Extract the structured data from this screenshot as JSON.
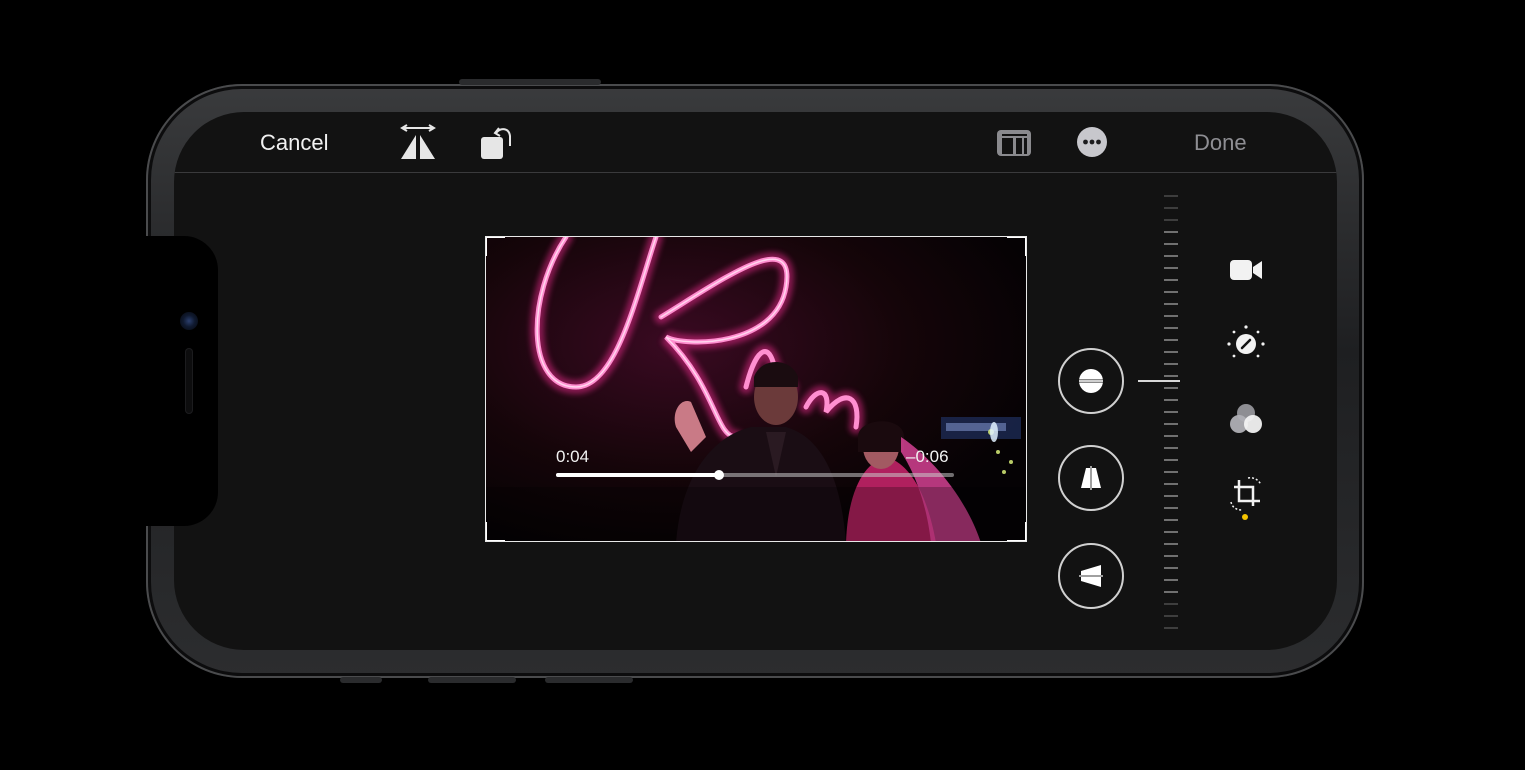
{
  "toolbar": {
    "cancel_label": "Cancel",
    "done_label": "Done",
    "flip_icon": "flip-horizontal-icon",
    "rotate_icon": "rotate-icon",
    "aspect_icon": "aspect-ratio-icon",
    "more_icon": "more-options-icon"
  },
  "video": {
    "elapsed": "0:04",
    "remaining": "–0:06",
    "progress": 0.41
  },
  "adjust_tools": {
    "straighten_icon": "straighten-icon",
    "vertical_icon": "vertical-perspective-icon",
    "horizontal_icon": "horizontal-perspective-icon"
  },
  "edit_modes": {
    "video_icon": "video-camera-icon",
    "adjust_icon": "adjust-dial-icon",
    "filters_icon": "filters-icon",
    "crop_icon": "crop-rotate-icon",
    "active_indicator_color": "#f5c400"
  },
  "colors": {
    "neon_pink": "#ff2f9a",
    "ui_text": "#f2f2f2",
    "done_disabled": "#8e8e93"
  }
}
